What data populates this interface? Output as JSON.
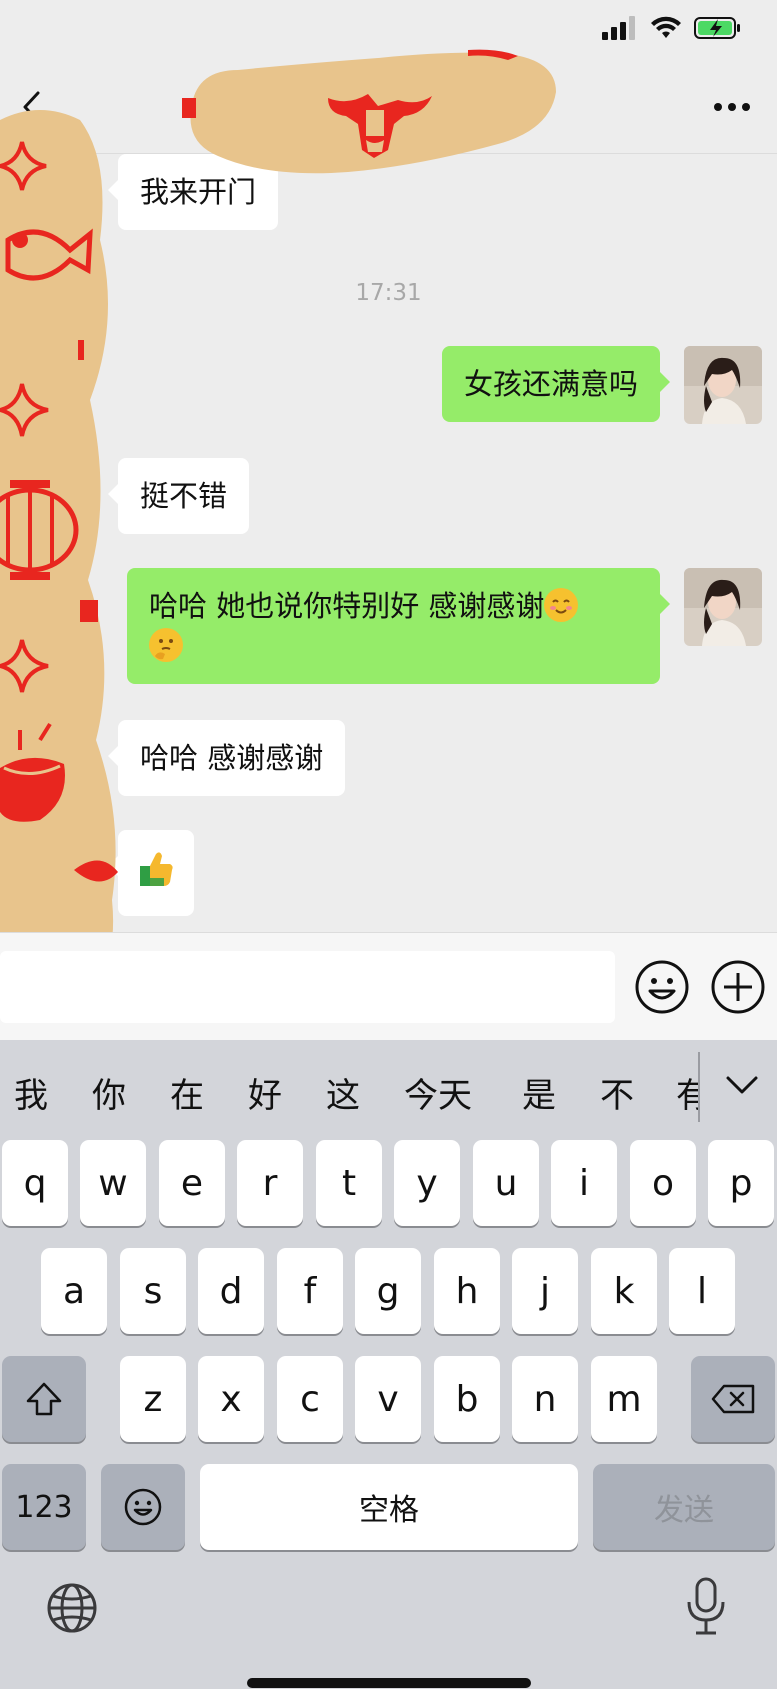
{
  "status_bar": {
    "icons": [
      "signal-icon",
      "wifi-icon",
      "battery-charging-icon"
    ]
  },
  "header": {
    "back_icon": "chevron-left-icon",
    "more_icon": "ellipsis-icon"
  },
  "chat": {
    "messages": [
      {
        "side": "in",
        "text": "我来开门"
      },
      {
        "side": "out",
        "text": "女孩还满意吗"
      },
      {
        "side": "in",
        "text": "挺不错"
      },
      {
        "side": "out",
        "text_line1": "哈哈 她也说你特别好 感谢感谢",
        "emojis": [
          "smiling-face-emoji",
          "thinking-face-emoji"
        ]
      },
      {
        "side": "in",
        "text": "哈哈 感谢感谢"
      },
      {
        "side": "in",
        "emoji": "thumbs-up-emoji"
      }
    ],
    "timestamp": "17:31"
  },
  "input_bar": {
    "text_value": "",
    "emoji_icon": "smiley-icon",
    "plus_icon": "plus-circle-icon"
  },
  "keyboard": {
    "candidates": [
      "我",
      "你",
      "在",
      "好",
      "这",
      "今天",
      "是",
      "不",
      "有"
    ],
    "row1": [
      "q",
      "w",
      "e",
      "r",
      "t",
      "y",
      "u",
      "i",
      "o",
      "p"
    ],
    "row2": [
      "a",
      "s",
      "d",
      "f",
      "g",
      "h",
      "j",
      "k",
      "l"
    ],
    "row3": [
      "z",
      "x",
      "c",
      "v",
      "b",
      "n",
      "m"
    ],
    "key_123": "123",
    "space_label": "空格",
    "send_label": "发送"
  },
  "colors": {
    "outgoing_bubble": "#95ec69",
    "incoming_bubble": "#ffffff",
    "chat_bg": "#ededed",
    "keyboard_bg": "#d3d5da",
    "sticker_red": "#e8261f",
    "sticker_gold": "#e8c48c"
  }
}
